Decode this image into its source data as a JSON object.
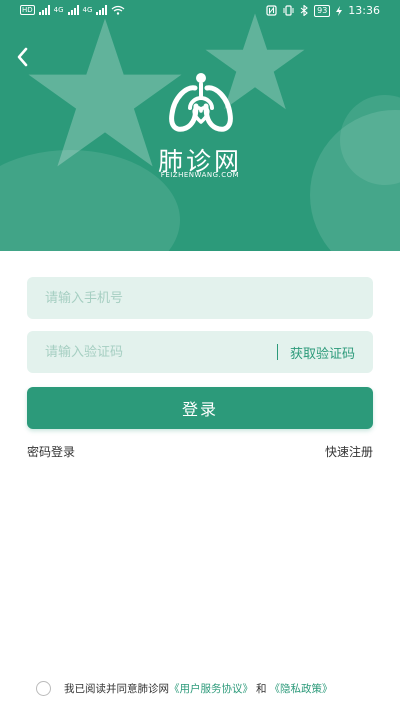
{
  "status_bar": {
    "network_tag_1": "HD",
    "network_tag_2": "HD",
    "net_type_1": "4G",
    "net_type_2": "4G",
    "battery": "93",
    "time": "13:36"
  },
  "icons": {
    "back": "back-chevron-icon",
    "logo": "lung-logo-icon"
  },
  "colors": {
    "brand": "#2c9a7a",
    "input_bg": "#e3f2ed"
  },
  "header": {
    "brand_name": "肺诊网",
    "brand_domain": "FEIZHENWANG.COM"
  },
  "form": {
    "phone_placeholder": "请输入手机号",
    "phone_value": "",
    "code_placeholder": "请输入验证码",
    "code_value": "",
    "get_code_label": "获取验证码",
    "login_label": "登录",
    "password_login_label": "密码登录",
    "quick_register_label": "快速注册"
  },
  "agreement": {
    "checked": false,
    "prefix": "我已阅读并同意肺诊网",
    "user_agreement": "《用户服务协议》",
    "and": "和",
    "privacy_policy": "《隐私政策》"
  }
}
